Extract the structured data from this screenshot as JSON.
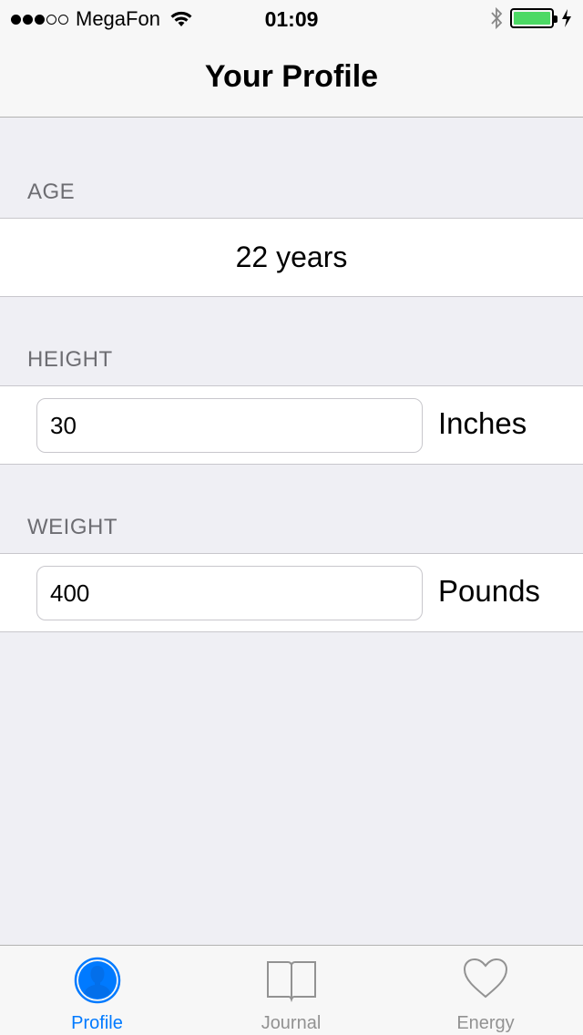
{
  "status_bar": {
    "carrier": "MegaFon",
    "time": "01:09",
    "signal_filled": 3,
    "signal_total": 5,
    "battery_level": 1.0,
    "battery_color": "#4cd964"
  },
  "nav": {
    "title": "Your Profile"
  },
  "sections": {
    "age": {
      "header": "AGE",
      "value": "22 years"
    },
    "height": {
      "header": "HEIGHT",
      "value": "30",
      "unit": "Inches"
    },
    "weight": {
      "header": "WEIGHT",
      "value": "400",
      "unit": "Pounds"
    }
  },
  "tabs": [
    {
      "label": "Profile",
      "icon": "person-icon",
      "active": true
    },
    {
      "label": "Journal",
      "icon": "book-icon",
      "active": false
    },
    {
      "label": "Energy",
      "icon": "heart-icon",
      "active": false
    }
  ],
  "colors": {
    "accent": "#007aff",
    "inactive": "#929292",
    "background": "#efeff4"
  }
}
